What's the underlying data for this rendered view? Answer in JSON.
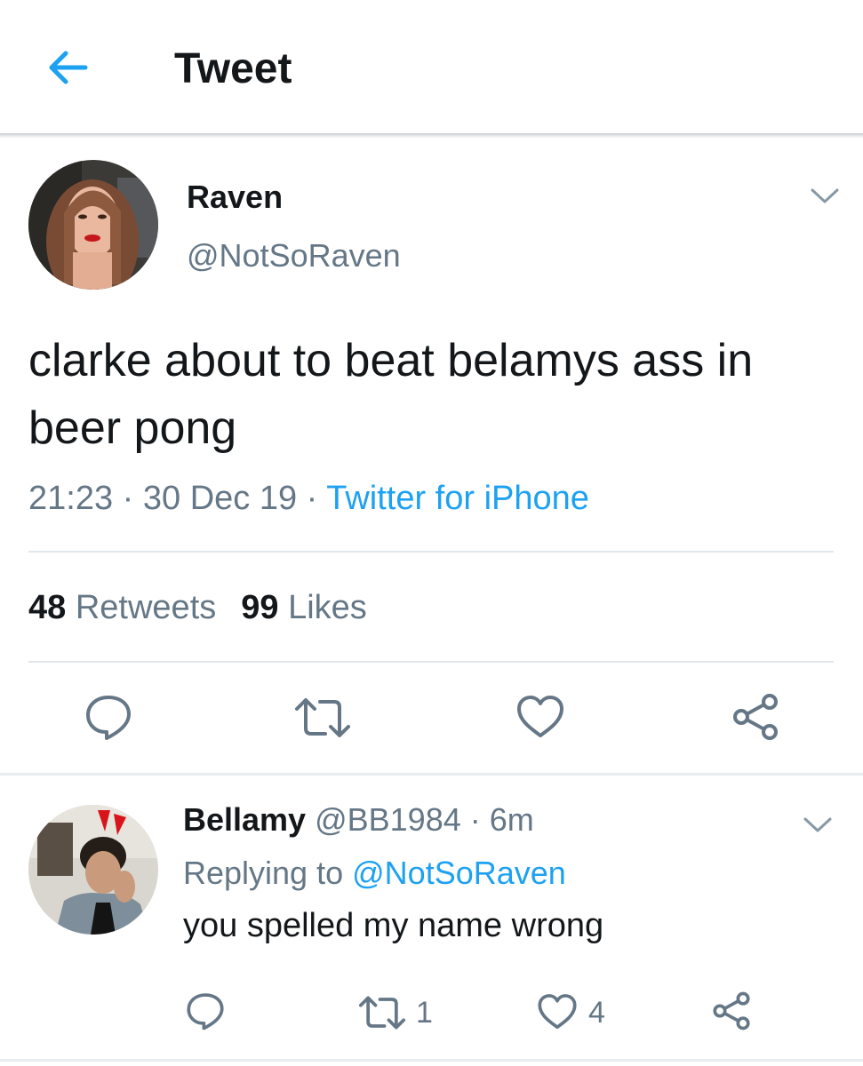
{
  "header": {
    "title": "Tweet",
    "back_icon": "arrow-left-icon",
    "accent": "#1da1f2"
  },
  "tweet": {
    "author_name": "Raven",
    "author_handle": "@NotSoRaven",
    "text": "clarke about to beat belamys ass in beer pong",
    "time": "21:23",
    "date": "30 Dec 19",
    "sep": " · ",
    "source": "Twitter for iPhone",
    "retweets_count": "48",
    "retweets_label": "Retweets",
    "likes_count": "99",
    "likes_label": "Likes",
    "actions": [
      "reply-icon",
      "retweet-icon",
      "like-icon",
      "share-icon"
    ]
  },
  "reply": {
    "author_name": "Bellamy",
    "author_handle": "@BB1984",
    "time": "6m",
    "replying_prefix": "Replying to",
    "replying_to": "@NotSoRaven",
    "text": "you spelled my name wrong",
    "retweets_count": "1",
    "likes_count": "4"
  },
  "colors": {
    "text": "#14171a",
    "secondary": "#657786",
    "link": "#1da1f2",
    "divider": "#e1e8ed"
  }
}
